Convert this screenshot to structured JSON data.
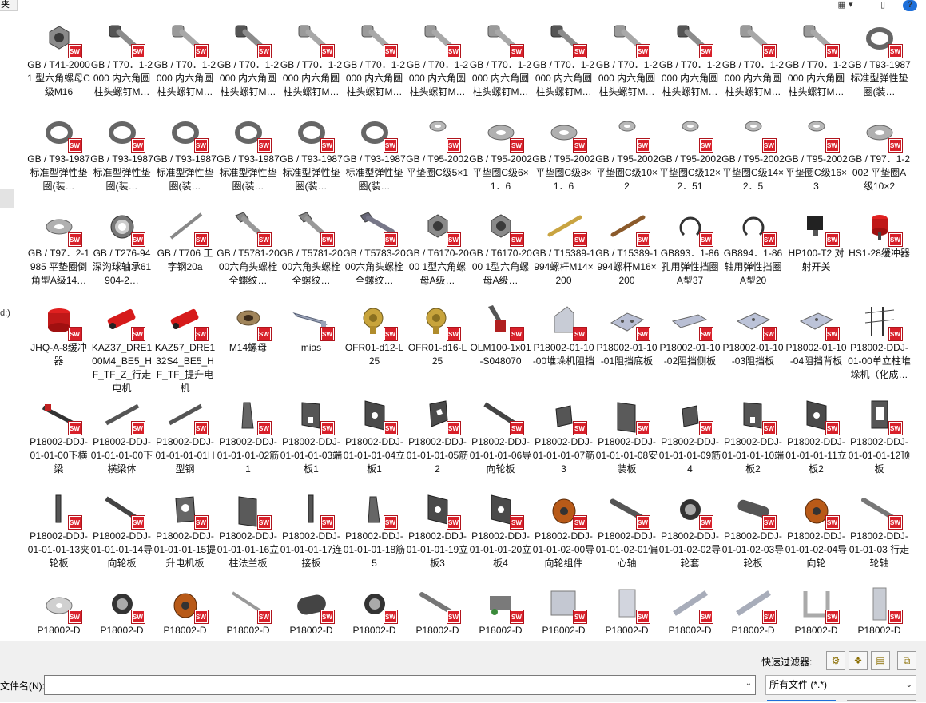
{
  "window": {
    "left_tab_fragment": "夹",
    "view_icon": "view-grid-icon",
    "pane_icon": "preview-pane-icon",
    "help_icon": "?"
  },
  "sidebar": {
    "drive_fragment": "d:)"
  },
  "badge": {
    "text": "SW",
    "color": "#d8202a"
  },
  "files": [
    {
      "name": "GB / T41-20001 型六角螺母C级M16",
      "icon": "hex-nut"
    },
    {
      "name": "GB / T70．1-2000 内六角圆柱头螺钉M…",
      "icon": "cap-screw-dark"
    },
    {
      "name": "GB / T70．1-2000 内六角圆柱头螺钉M…",
      "icon": "cap-screw"
    },
    {
      "name": "GB / T70．1-2000 内六角圆柱头螺钉M…",
      "icon": "cap-screw-dark"
    },
    {
      "name": "GB / T70．1-2000 内六角圆柱头螺钉M…",
      "icon": "cap-screw"
    },
    {
      "name": "GB / T70．1-2000 内六角圆柱头螺钉M…",
      "icon": "cap-screw"
    },
    {
      "name": "GB / T70．1-2000 内六角圆柱头螺钉M…",
      "icon": "cap-screw"
    },
    {
      "name": "GB / T70．1-2000 内六角圆柱头螺钉M…",
      "icon": "cap-screw"
    },
    {
      "name": "GB / T70．1-2000 内六角圆柱头螺钉M…",
      "icon": "cap-screw-dark"
    },
    {
      "name": "GB / T70．1-2000 内六角圆柱头螺钉M…",
      "icon": "cap-screw"
    },
    {
      "name": "GB / T70．1-2000 内六角圆柱头螺钉M…",
      "icon": "cap-screw-dark"
    },
    {
      "name": "GB / T70．1-2000 内六角圆柱头螺钉M…",
      "icon": "cap-screw"
    },
    {
      "name": "GB / T70．1-2000 内六角圆柱头螺钉M…",
      "icon": "cap-screw"
    },
    {
      "name": "GB / T93-1987 标准型弹性垫圈(装…",
      "icon": "spring-washer"
    },
    {
      "name": "GB / T93-1987 标准型弹性垫圈(装…",
      "icon": "spring-washer"
    },
    {
      "name": "GB / T93-1987 标准型弹性垫圈(装…",
      "icon": "spring-washer"
    },
    {
      "name": "GB / T93-1987 标准型弹性垫圈(装…",
      "icon": "spring-washer"
    },
    {
      "name": "GB / T93-1987 标准型弹性垫圈(装…",
      "icon": "spring-washer"
    },
    {
      "name": "GB / T93-1987 标准型弹性垫圈(装…",
      "icon": "spring-washer"
    },
    {
      "name": "GB / T93-1987 标准型弹性垫圈(装…",
      "icon": "spring-washer"
    },
    {
      "name": "GB / T95-2002 平垫圈C级5×1",
      "icon": "flat-washer-small"
    },
    {
      "name": "GB / T95-2002 平垫圈C级6×1．6",
      "icon": "flat-washer"
    },
    {
      "name": "GB / T95-2002 平垫圈C级8×1．6",
      "icon": "flat-washer"
    },
    {
      "name": "GB / T95-2002 平垫圈C级10×2",
      "icon": "flat-washer-small"
    },
    {
      "name": "GB / T95-2002 平垫圈C级12×2．51",
      "icon": "flat-washer-small"
    },
    {
      "name": "GB / T95-2002 平垫圈C级14×2．5",
      "icon": "flat-washer-small"
    },
    {
      "name": "GB / T95-2002 平垫圈C级16×3",
      "icon": "flat-washer-small"
    },
    {
      "name": "GB / T97．1-2002 平垫圈A级10×2",
      "icon": "flat-washer"
    },
    {
      "name": "GB / T97．2-1985 平垫圈倒角型A级14…",
      "icon": "flat-washer"
    },
    {
      "name": "GB / T276-94深沟球轴承61904-2…",
      "icon": "bearing"
    },
    {
      "name": "GB / T706 工字钢20a",
      "icon": "i-beam"
    },
    {
      "name": "GB / T5781-2000六角头螺栓全螺纹…",
      "icon": "hex-bolt"
    },
    {
      "name": "GB / T5781-2000六角头螺栓全螺纹…",
      "icon": "hex-bolt"
    },
    {
      "name": "GB / T5783-2000六角头螺栓全螺纹…",
      "icon": "hex-bolt-long"
    },
    {
      "name": "GB / T6170-2000 1型六角螺母A级…",
      "icon": "hex-nut"
    },
    {
      "name": "GB / T6170-2000 1型六角螺母A级…",
      "icon": "hex-nut"
    },
    {
      "name": "GB / T15389-1994螺杆M14×200",
      "icon": "rod-gold"
    },
    {
      "name": "GB / T15389-1994螺杆M16×200",
      "icon": "rod-brown"
    },
    {
      "name": "GB893．1-86孔用弹性挡圈A型37",
      "icon": "circlip"
    },
    {
      "name": "GB894．1-86轴用弹性挡圈A型20",
      "icon": "circlip"
    },
    {
      "name": "HP100-T2 对射开关",
      "icon": "sensor"
    },
    {
      "name": "HS1-28缓冲器",
      "icon": "buffer"
    },
    {
      "name": "JHQ-A-8缓冲器",
      "icon": "buffer-big"
    },
    {
      "name": "KAZ37_DRE100M4_BE5_HF_TF_Z_行走电机",
      "icon": "motor"
    },
    {
      "name": "KAZ57_DRE132S4_BE5_HF_TF_提升电机",
      "icon": "motor"
    },
    {
      "name": "M14螺母",
      "icon": "nut-brown"
    },
    {
      "name": "mias",
      "icon": "bracket-flat"
    },
    {
      "name": "OFR01-d12-L25",
      "icon": "roller-gold"
    },
    {
      "name": "OFR01-d16-L25",
      "icon": "roller-gold"
    },
    {
      "name": "OLM100-1x01-S048070",
      "icon": "limit-switch"
    },
    {
      "name": "P18002-01-10-00堆垛机阻挡",
      "icon": "stopper"
    },
    {
      "name": "P18002-01-10-01阻挡底板",
      "icon": "plate-holes"
    },
    {
      "name": "P18002-01-10-02阻挡侧板",
      "icon": "plate-angled"
    },
    {
      "name": "P18002-01-10-03阻挡板",
      "icon": "plate-square"
    },
    {
      "name": "P18002-01-10-04阻挡背板",
      "icon": "plate-square"
    },
    {
      "name": "P18002-DDJ-01-00单立柱堆垛机（化成…",
      "icon": "stacker"
    },
    {
      "name": "P18002-DDJ-01-01-00下横梁",
      "icon": "crossbeam"
    },
    {
      "name": "P18002-DDJ-01-01-01-00下横梁体",
      "icon": "beam-long"
    },
    {
      "name": "P18002-DDJ-01-01-01-01H型钢",
      "icon": "beam-long"
    },
    {
      "name": "P18002-DDJ-01-01-01-02筋1",
      "icon": "rib"
    },
    {
      "name": "P18002-DDJ-01-01-01-03端板1",
      "icon": "end-plate"
    },
    {
      "name": "P18002-DDJ-01-01-01-04立板1",
      "icon": "plate-hole"
    },
    {
      "name": "P18002-DDJ-01-01-01-05筋2",
      "icon": "plate-hex"
    },
    {
      "name": "P18002-DDJ-01-01-01-06导向轮板",
      "icon": "bar-diag"
    },
    {
      "name": "P18002-DDJ-01-01-01-07筋3",
      "icon": "plate-small"
    },
    {
      "name": "P18002-DDJ-01-01-01-08安装板",
      "icon": "plate-thick"
    },
    {
      "name": "P18002-DDJ-01-01-01-09筋4",
      "icon": "plate-small"
    },
    {
      "name": "P18002-DDJ-01-01-01-10端板2",
      "icon": "end-plate"
    },
    {
      "name": "P18002-DDJ-01-01-01-11立板2",
      "icon": "plate-hole"
    },
    {
      "name": "P18002-DDJ-01-01-01-12顶板",
      "icon": "frame-plate"
    },
    {
      "name": "P18002-DDJ-01-01-01-13夹轮板",
      "icon": "strip"
    },
    {
      "name": "P18002-DDJ-01-01-01-14导向轮板",
      "icon": "bar-diag"
    },
    {
      "name": "P18002-DDJ-01-01-01-15提升电机板",
      "icon": "plate-hole-round"
    },
    {
      "name": "P18002-DDJ-01-01-01-16立柱法兰板",
      "icon": "plate-thick"
    },
    {
      "name": "P18002-DDJ-01-01-01-17连接板",
      "icon": "strip"
    },
    {
      "name": "P18002-DDJ-01-01-01-18筋5",
      "icon": "rib"
    },
    {
      "name": "P18002-DDJ-01-01-01-19立板3",
      "icon": "plate-hole"
    },
    {
      "name": "P18002-DDJ-01-01-01-20立板4",
      "icon": "plate-hole"
    },
    {
      "name": "P18002-DDJ-01-01-02-00导向轮组件",
      "icon": "wheel-orange"
    },
    {
      "name": "P18002-DDJ-01-01-02-01偏心轴",
      "icon": "shaft"
    },
    {
      "name": "P18002-DDJ-01-01-02-02导轮套",
      "icon": "sleeve"
    },
    {
      "name": "P18002-DDJ-01-01-02-03导轮板",
      "icon": "bar-plate"
    },
    {
      "name": "P18002-DDJ-01-01-02-04导向轮",
      "icon": "wheel-orange"
    },
    {
      "name": "P18002-DDJ-01-01-03 行走轮轴",
      "icon": "shaft-long"
    },
    {
      "name": "P18002-D",
      "icon": "disc"
    },
    {
      "name": "P18002-D",
      "icon": "sleeve"
    },
    {
      "name": "P18002-D",
      "icon": "wheel-orange"
    },
    {
      "name": "P18002-D",
      "icon": "shaft-thin"
    },
    {
      "name": "P18002-D",
      "icon": "cylinder-dark"
    },
    {
      "name": "P18002-D",
      "icon": "sleeve"
    },
    {
      "name": "P18002-D",
      "icon": "shaft-long"
    },
    {
      "name": "P18002-D",
      "icon": "assembly"
    },
    {
      "name": "P18002-D",
      "icon": "rail-part"
    },
    {
      "name": "P18002-D",
      "icon": "plate-rect"
    },
    {
      "name": "P18002-D",
      "icon": "rail-long"
    },
    {
      "name": "P18002-D",
      "icon": "rail-long"
    },
    {
      "name": "P18002-D",
      "icon": "bracket-u"
    },
    {
      "name": "P18002-D",
      "icon": "column"
    }
  ],
  "bottom": {
    "filter_label": "快速过滤器:",
    "filter_buttons": [
      "filter-parts-icon",
      "filter-assemblies-icon",
      "filter-drawings-icon",
      "filter-toplevel-icon"
    ],
    "filename_label": "文件名(N):",
    "filename_value": "",
    "filetype_value": "所有文件 (*.*)"
  }
}
